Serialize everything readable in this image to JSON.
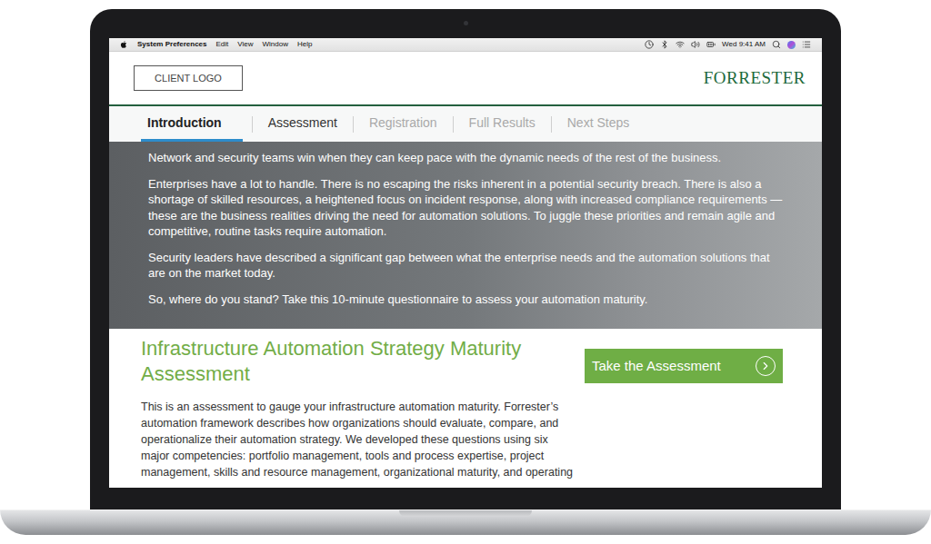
{
  "menubar": {
    "app": "System Preferences",
    "items": [
      "Edit",
      "View",
      "Window",
      "Help"
    ],
    "clock": "Wed 9:41 AM"
  },
  "header": {
    "client_logo": "CLIENT LOGO",
    "brand": "FORRESTER"
  },
  "tabs": [
    {
      "label": "Introduction",
      "selected": true,
      "disabled": false
    },
    {
      "label": "Assessment",
      "selected": false,
      "disabled": false
    },
    {
      "label": "Registration",
      "selected": false,
      "disabled": true
    },
    {
      "label": "Full Results",
      "selected": false,
      "disabled": true
    },
    {
      "label": "Next Steps",
      "selected": false,
      "disabled": true
    }
  ],
  "hero": {
    "paragraphs": [
      "Network and security teams win when they can keep pace with the dynamic needs of the rest of the business.",
      "Enterprises have a lot to handle. There is no escaping the risks inherent in a potential security breach. There is also a shortage of skilled resources, a heightened focus on incident response, along with increased compliance requirements — these are the business realities driving the need for automation solutions. To juggle these priorities and remain agile and competitive, routine tasks require automation.",
      "Security leaders have described a significant gap between what the enterprise needs and the automation solutions that are on the market today.",
      "So, where do you stand? Take this 10-minute questionnaire to assess your automation maturity."
    ]
  },
  "assessment": {
    "title": "Infrastructure Automation Strategy Maturity Assessment",
    "button": "Take the Assessment",
    "description": "This is an assessment to gauge your infrastructure automation maturity. Forrester’s automation framework describes how organizations should evaluate, compare, and operationalize their automation strategy. We developed these questions using six major competencies: portfolio management, tools and process expertise, project management, skills and resource management, organizational maturity, and operating"
  }
}
